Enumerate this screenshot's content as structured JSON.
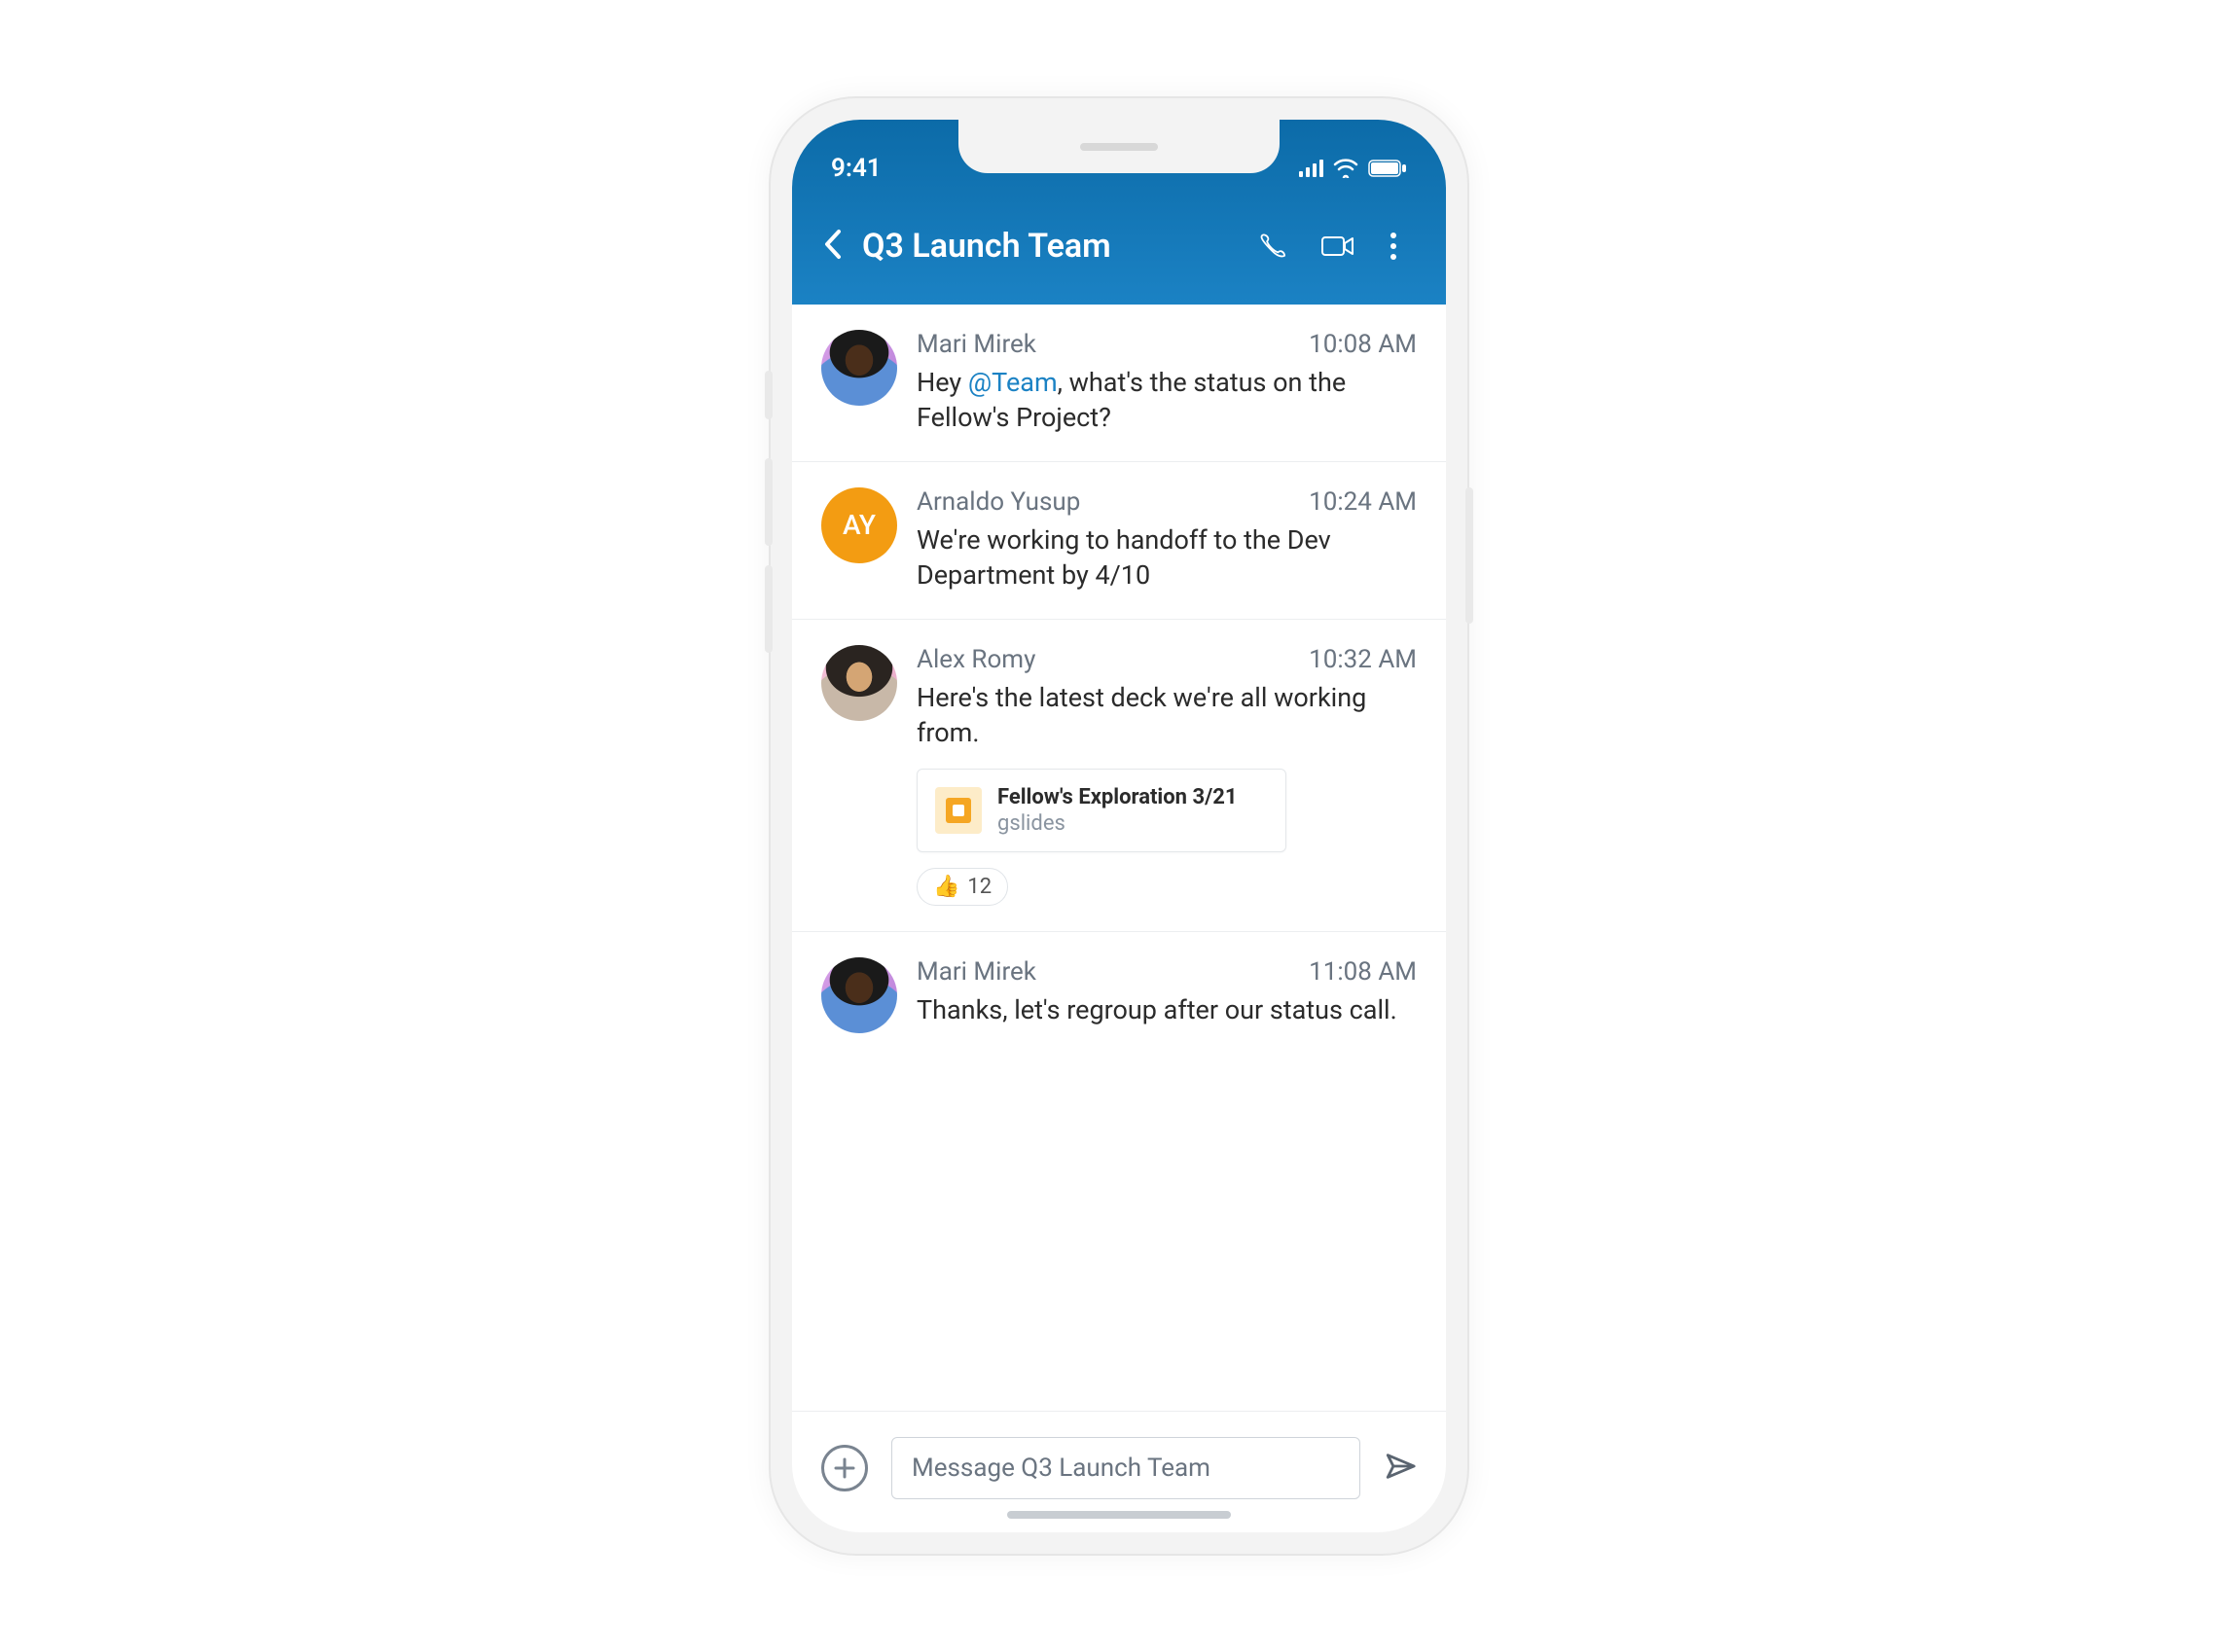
{
  "status": {
    "time": "9:41"
  },
  "header": {
    "title": "Q3 Launch Team"
  },
  "messages": [
    {
      "author": "Mari Mirek",
      "time": "10:08 AM",
      "text_pre": "Hey ",
      "mention": "@Team",
      "text_post": ", what's the status on the Fellow's Project?",
      "avatar": "photo1"
    },
    {
      "author": "Arnaldo Yusup",
      "time": "10:24 AM",
      "text": "We're working to handoff to the Dev Department by 4/10",
      "avatar": "initials",
      "initials": "AY"
    },
    {
      "author": "Alex Romy",
      "time": "10:32 AM",
      "text": "Here's the latest deck we're all working from.",
      "avatar": "photo2",
      "attachment": {
        "title": "Fellow's Exploration 3/21",
        "type": "gslides"
      },
      "reaction": {
        "emoji": "👍",
        "count": "12"
      }
    },
    {
      "author": "Mari Mirek",
      "time": "11:08 AM",
      "text": "Thanks, let's regroup after our status call.",
      "avatar": "photo1"
    }
  ],
  "composer": {
    "placeholder": "Message Q3 Launch Team"
  }
}
